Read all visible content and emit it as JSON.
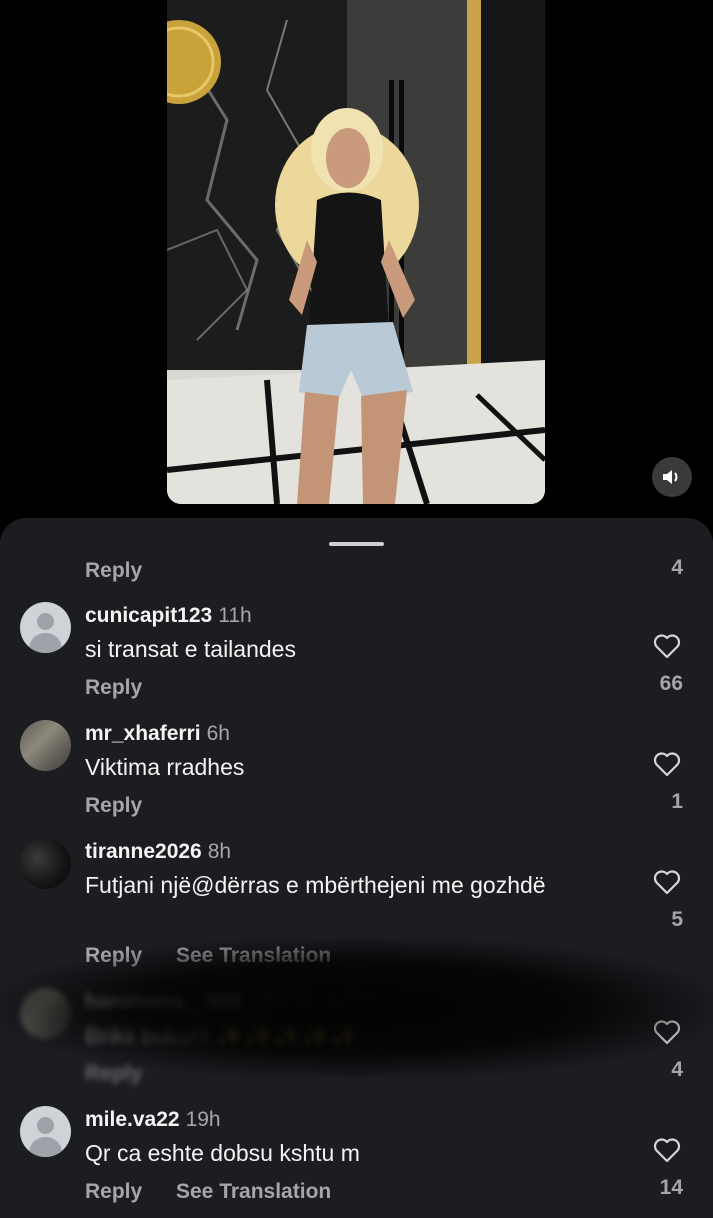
{
  "sheet": {
    "first_reply_label": "Reply",
    "first_like_count": "4"
  },
  "comments": [
    {
      "username": "cunicapit123",
      "time": "11h",
      "text": "si transat e tailandes",
      "reply": "Reply",
      "likes": "66"
    },
    {
      "username": "mr_xhaferri",
      "time": "6h",
      "text": "Viktima rradhes",
      "reply": "Reply",
      "likes": "1"
    },
    {
      "username": "tiranne2026",
      "time": "8h",
      "text": "Futjani një@dërras e mbërthejeni me gozhdë",
      "reply": "Reply",
      "see_translation": "See Translation",
      "likes": "5"
    },
    {
      "username": "hanahana__908",
      "time": "22h",
      "badge": "by author",
      "text": "Brikii bukurii ✨✨✨✨✨",
      "reply": "Reply",
      "likes": "4"
    },
    {
      "username": "mile.va22",
      "time": "19h",
      "text": "Qr ca eshte dobsu kshtu m",
      "reply": "Reply",
      "see_translation": "See Translation",
      "likes": "14"
    }
  ],
  "icons": {
    "sound": "speaker-icon",
    "like": "heart-outline-icon",
    "avatar_default": "default-avatar-icon"
  },
  "colors": {
    "background": "#000000",
    "sheet": "#1c1d21",
    "secondary_text": "#a5a6aa"
  }
}
